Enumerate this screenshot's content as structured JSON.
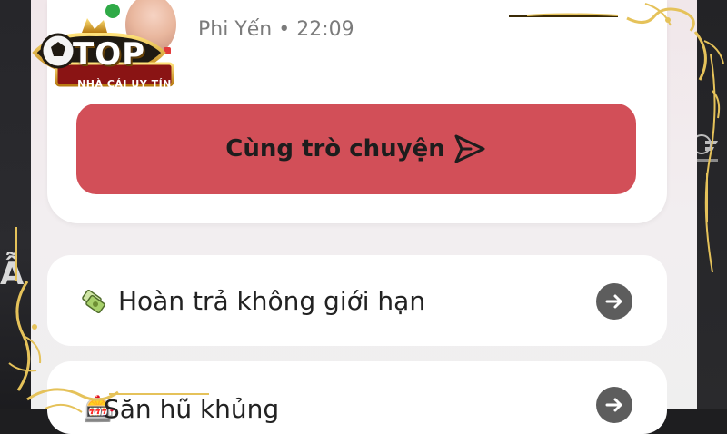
{
  "logo": {
    "brand": "TOP",
    "tagline": "NHÀ CÁI UY TÍN"
  },
  "post": {
    "author": "Phi Yến",
    "time": "22:09",
    "author_line": "Phi Yến • 22:09"
  },
  "chat_button": {
    "label": "Cùng trò chuyện",
    "icon": "send-icon"
  },
  "features": [
    {
      "label": "Hoàn trả không giới hạn",
      "icon": "refund-icon",
      "action_icon": "arrow-right-icon"
    },
    {
      "label": "Săn hũ khủng",
      "icon": "jackpot-icon",
      "action_icon": "arrow-right-icon"
    }
  ],
  "background": {
    "left_partial_text": "Ẫ"
  },
  "colors": {
    "accent": "#d24f58",
    "online": "#2faa47",
    "ornament_gold": "#e5c25a"
  }
}
